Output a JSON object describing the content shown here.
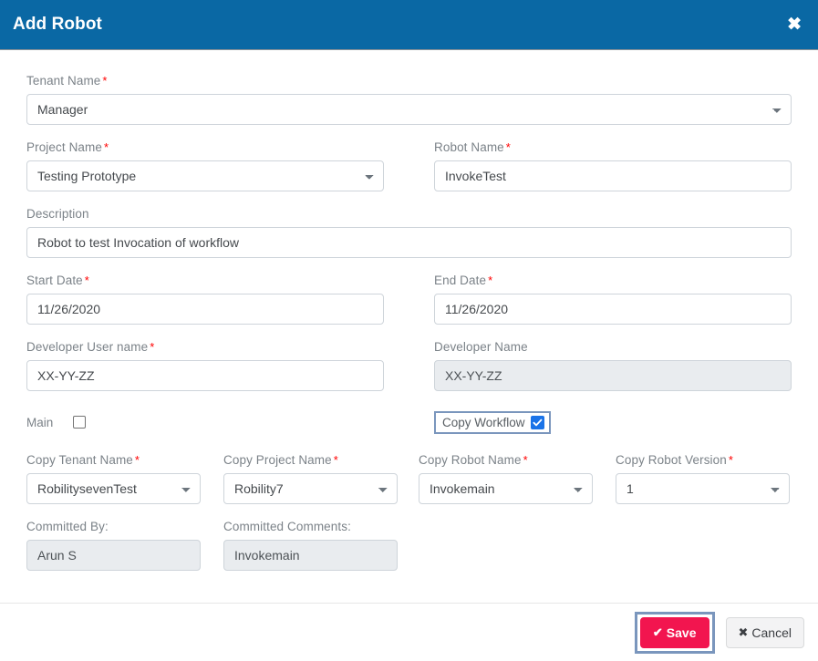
{
  "header": {
    "title": "Add Robot",
    "close_icon": "close-x-icon",
    "bg_color": "#0a68a4"
  },
  "form": {
    "tenant_name": {
      "label": "Tenant Name",
      "required": "*",
      "value": "Manager"
    },
    "project_name": {
      "label": "Project Name",
      "required": "*",
      "value": "Testing Prototype"
    },
    "robot_name": {
      "label": "Robot Name",
      "required": "*",
      "value": "InvokeTest",
      "placeholder": ""
    },
    "description": {
      "label": "Description",
      "value": "Robot to test Invocation of workflow",
      "placeholder": ""
    },
    "start_date": {
      "label": "Start Date",
      "required": "*",
      "value": "11/26/2020"
    },
    "end_date": {
      "label": "End Date",
      "required": "*",
      "value": "11/26/2020"
    },
    "developer_user_name": {
      "label": "Developer User name",
      "required": "*",
      "value": "XX-YY-ZZ"
    },
    "developer_name": {
      "label": "Developer Name",
      "value": "XX-YY-ZZ"
    },
    "main": {
      "label": "Main",
      "checked": false
    },
    "copy_workflow": {
      "label": "Copy Workflow",
      "checked": true,
      "checkbox_color": "#1a73e8",
      "focus_border_color": "#7a96bd"
    },
    "copy_tenant_name": {
      "label": "Copy Tenant Name",
      "required": "*",
      "value": "RobilitysevenTest"
    },
    "copy_project_name": {
      "label": "Copy Project Name",
      "required": "*",
      "value": "Robility7"
    },
    "copy_robot_name": {
      "label": "Copy Robot Name",
      "required": "*",
      "value": "Invokemain"
    },
    "copy_robot_version": {
      "label": "Copy Robot Version",
      "required": "*",
      "value": "1"
    },
    "committed_by": {
      "label": "Committed By:",
      "value": "Arun S"
    },
    "committed_comments": {
      "label": "Committed Comments:",
      "value": "Invokemain"
    }
  },
  "footer": {
    "save_label": "Save",
    "save_icon": "check-icon",
    "save_color": "#f2154f",
    "cancel_label": "Cancel",
    "cancel_icon": "close-x-icon"
  }
}
